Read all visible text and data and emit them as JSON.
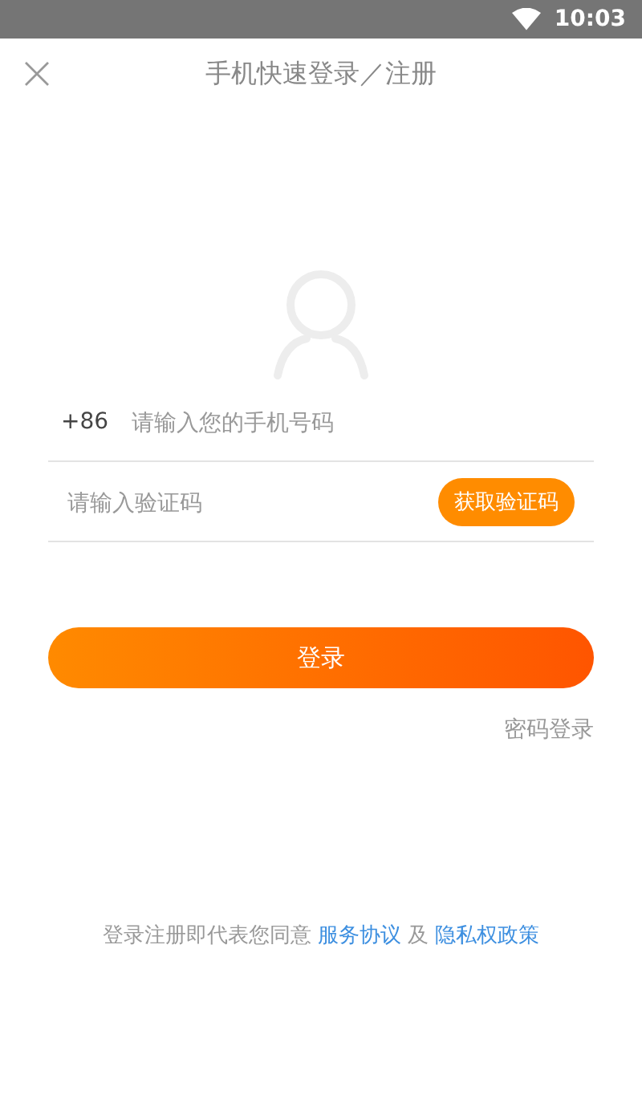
{
  "status_bar": {
    "time": "10:03"
  },
  "header": {
    "title": "手机快速登录／注册"
  },
  "phone_field": {
    "country_code": "+86",
    "placeholder": "请输入您的手机号码"
  },
  "code_field": {
    "placeholder": "请输入验证码",
    "send_button": "获取验证码"
  },
  "login_button": "登录",
  "password_login_link": "密码登录",
  "agreement": {
    "text": "登录注册即代表您同意",
    "terms_link": "服务协议",
    "joiner": "及",
    "privacy_link": "隐私权政策"
  }
}
